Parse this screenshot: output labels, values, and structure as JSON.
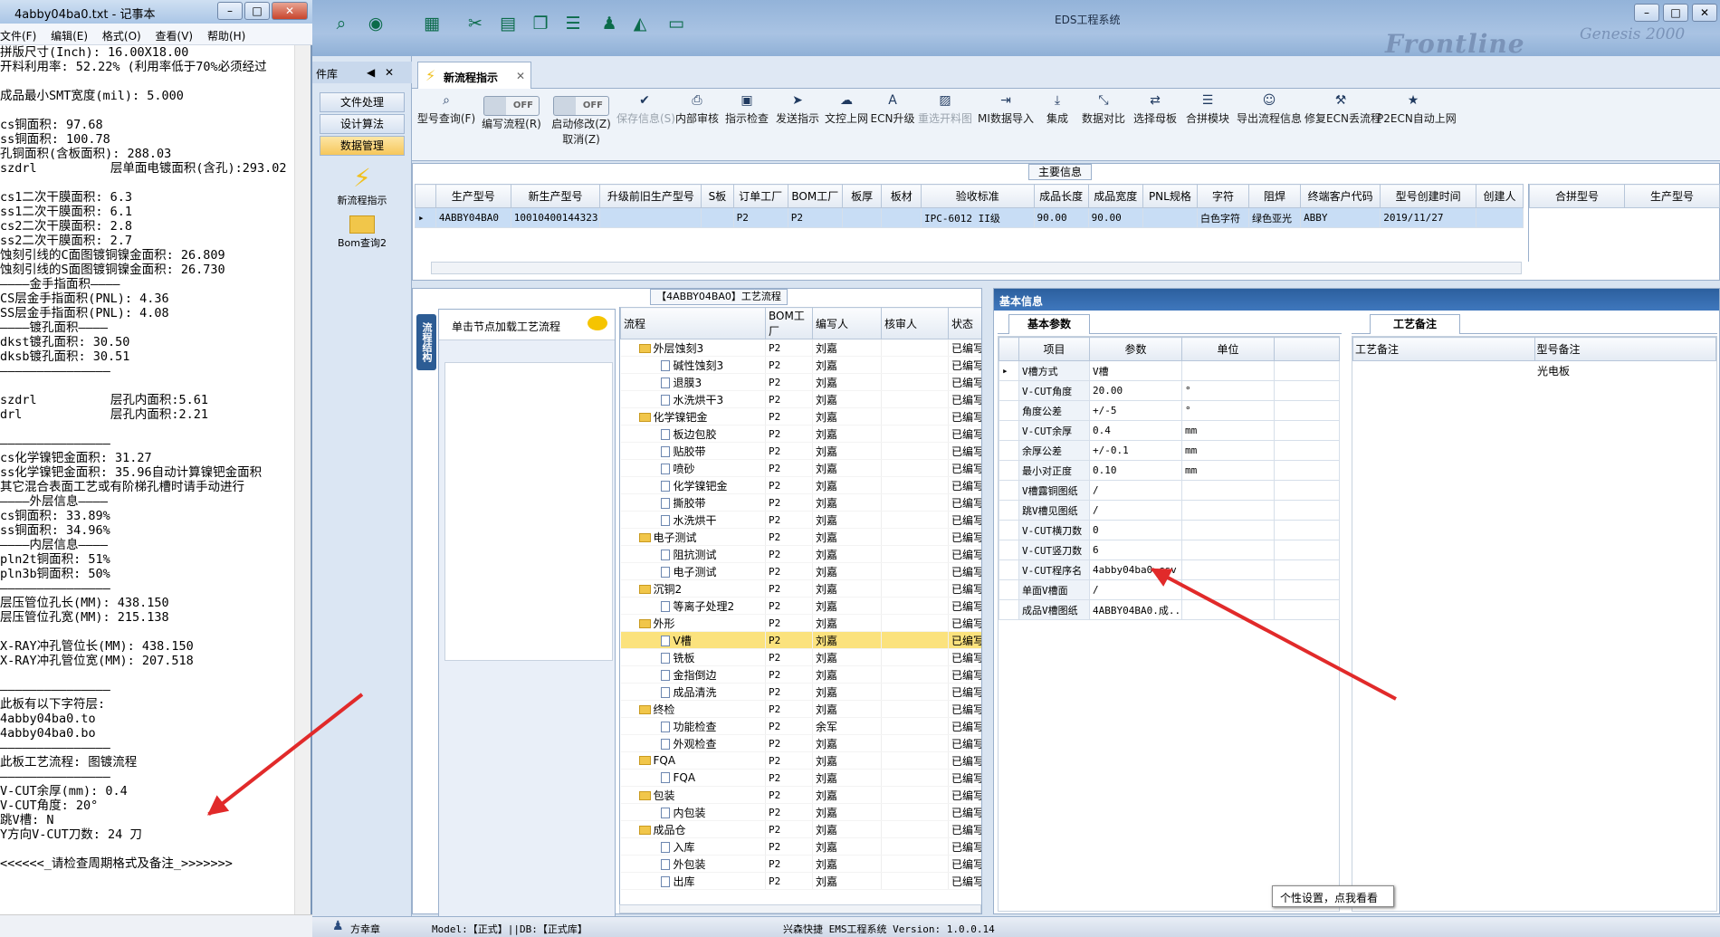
{
  "notepad": {
    "title": "4abby04ba0.txt - 记事本",
    "menu": [
      "文件(F)",
      "编辑(E)",
      "格式(O)",
      "查看(V)",
      "帮助(H)"
    ],
    "lines": [
      "拼版尺寸(Inch): 16.00X18.00",
      "开料利用率: 52.22% (利用率低于70%必须经过",
      "",
      "成品最小SMT宽度(mil): 5.000",
      "",
      "cs铜面积: 97.68",
      "ss铜面积: 100.78",
      "孔铜面积(含板面积): 288.03",
      "szdrl          层单面电镀面积(含孔):293.02",
      "",
      "cs1二次干膜面积: 6.3",
      "ss1二次干膜面积: 6.1",
      "cs2二次干膜面积: 2.8",
      "ss2二次干膜面积: 2.7",
      "蚀刻引线的C面图镀铜镍金面积: 26.809",
      "蚀刻引线的S面图镀铜镍金面积: 26.730",
      "————金手指面积————",
      "CS层金手指面积(PNL): 4.36",
      "SS层金手指面积(PNL): 4.08",
      "————镀孔面积————",
      "dkst镀孔面积: 30.50",
      "dksb镀孔面积: 30.51",
      "———————————————",
      "",
      "szdrl          层孔内面积:5.61",
      "drl            层孔内面积:2.21",
      "",
      "———————————————",
      "cs化学镍钯金面积: 31.27",
      "ss化学镍钯金面积: 35.96自动计算镍钯金面积",
      "其它混合表面工艺或有阶梯孔槽时请手动进行",
      "————外层信息————",
      "cs铜面积: 33.89%",
      "ss铜面积: 34.96%",
      "————内层信息————",
      "pln2t铜面积: 51%",
      "pln3b铜面积: 50%",
      "———————————————",
      "层压管位孔长(MM): 438.150",
      "层压管位孔宽(MM): 215.138",
      "",
      "X-RAY冲孔管位长(MM): 438.150",
      "X-RAY冲孔管位宽(MM): 207.518",
      "",
      "———————————————",
      "此板有以下字符层:",
      "4abby04ba0.to",
      "4abby04ba0.bo",
      "———————————————",
      "此板工艺流程: 图镀流程",
      "———————————————",
      "V-CUT余厚(mm): 0.4",
      "V-CUT角度: 20°",
      "跳V槽: N",
      "Y方向V-CUT刀数: 24 刀",
      "",
      "<<<<<<_请检查周期格式及备注_>>>>>>>"
    ]
  },
  "app": {
    "title": "EDS工程系统",
    "brand": "Frontline",
    "brand2": "Genesis 2000",
    "library_header": "件库",
    "nav": [
      "文件处理",
      "设计算法",
      "数据管理"
    ],
    "nav_icons": [
      {
        "label": "新流程指示",
        "icon": "lightning-icon"
      },
      {
        "label": "Bom查询2",
        "icon": "folder-icon"
      }
    ],
    "active_tab": "新流程指示",
    "ribbon": [
      {
        "label": "型号查询(F)",
        "icon": "search-icon"
      },
      {
        "label": "编写流程(R)",
        "toggle": "OFF"
      },
      {
        "label": "启动修改(Z)",
        "sub": "取消(Z)",
        "toggle": "OFF"
      },
      {
        "label": "保存信息(S)",
        "icon": "check-icon",
        "disabled": true
      },
      {
        "label": "内部审核",
        "icon": "printer-icon"
      },
      {
        "label": "指示检查",
        "icon": "save-icon"
      },
      {
        "label": "发送指示",
        "icon": "send-icon"
      },
      {
        "label": "文控上网",
        "icon": "cloud-icon"
      },
      {
        "label": "ECN升级",
        "icon": "ecn-icon"
      },
      {
        "label": "重选开料图",
        "icon": "image-icon",
        "disabled": true
      },
      {
        "label": "MI数据导入",
        "icon": "import-icon"
      },
      {
        "label": "集成",
        "icon": "download-icon"
      },
      {
        "label": "数据对比",
        "icon": "compare-icon"
      },
      {
        "label": "选择母板",
        "icon": "shuffle-icon"
      },
      {
        "label": "合拼模块",
        "icon": "list-icon"
      },
      {
        "label": "导出流程信息",
        "icon": "smile-icon"
      },
      {
        "label": "修复ECN丢流程",
        "icon": "wrench-icon"
      },
      {
        "label": "P2ECN自动上网",
        "icon": "star-icon"
      }
    ]
  },
  "main_info": {
    "caption": "主要信息",
    "columns": [
      "生产型号",
      "新生产型号",
      "升级前旧生产型号",
      "S板",
      "订单工厂",
      "BOM工厂",
      "板厚",
      "板材",
      "验收标准",
      "成品长度",
      "成品宽度",
      "PNL规格",
      "字符",
      "阻焊",
      "终端客户代码",
      "型号创建时间",
      "创建人"
    ],
    "row": [
      "4ABBY04BA0",
      "10010400144323",
      "",
      "",
      "P2",
      "P2",
      "",
      "",
      "IPC-6012 II级",
      "90.00",
      "90.00",
      "",
      "白色字符",
      "绿色亚光",
      "ABBY",
      "2019/11/27",
      ""
    ],
    "right_columns": [
      "合拼型号",
      "生产型号"
    ]
  },
  "flow": {
    "caption": "【4ABBY04BA0】工艺流程",
    "vtab": "流程结构",
    "load_hint": "单击节点加载工艺流程",
    "columns": [
      "流程",
      "BOM工厂",
      "编写人",
      "核审人",
      "状态"
    ],
    "rows": [
      {
        "level": 1,
        "name": "外层蚀刻3",
        "bom": "P2",
        "author": "刘嘉",
        "status": "已编写"
      },
      {
        "level": 2,
        "name": "碱性蚀刻3",
        "bom": "P2",
        "author": "刘嘉",
        "status": "已编写"
      },
      {
        "level": 2,
        "name": "退膜3",
        "bom": "P2",
        "author": "刘嘉",
        "status": "已编写"
      },
      {
        "level": 2,
        "name": "水洗烘干3",
        "bom": "P2",
        "author": "刘嘉",
        "status": "已编写"
      },
      {
        "level": 1,
        "name": "化学镍钯金",
        "bom": "P2",
        "author": "刘嘉",
        "status": "已编写"
      },
      {
        "level": 2,
        "name": "板边包胶",
        "bom": "P2",
        "author": "刘嘉",
        "status": "已编写"
      },
      {
        "level": 2,
        "name": "贴胶带",
        "bom": "P2",
        "author": "刘嘉",
        "status": "已编写"
      },
      {
        "level": 2,
        "name": "喷砂",
        "bom": "P2",
        "author": "刘嘉",
        "status": "已编写"
      },
      {
        "level": 2,
        "name": "化学镍钯金",
        "bom": "P2",
        "author": "刘嘉",
        "status": "已编写"
      },
      {
        "level": 2,
        "name": "撕胶带",
        "bom": "P2",
        "author": "刘嘉",
        "status": "已编写"
      },
      {
        "level": 2,
        "name": "水洗烘干",
        "bom": "P2",
        "author": "刘嘉",
        "status": "已编写"
      },
      {
        "level": 1,
        "name": "电子测试",
        "bom": "P2",
        "author": "刘嘉",
        "status": "已编写"
      },
      {
        "level": 2,
        "name": "阻抗测试",
        "bom": "P2",
        "author": "刘嘉",
        "status": "已编写"
      },
      {
        "level": 2,
        "name": "电子测试",
        "bom": "P2",
        "author": "刘嘉",
        "status": "已编写"
      },
      {
        "level": 1,
        "name": "沉铜2",
        "bom": "P2",
        "author": "刘嘉",
        "status": "已编写"
      },
      {
        "level": 2,
        "name": "等离子处理2",
        "bom": "P2",
        "author": "刘嘉",
        "status": "已编写"
      },
      {
        "level": 1,
        "name": "外形",
        "bom": "P2",
        "author": "刘嘉",
        "status": "已编写"
      },
      {
        "level": 2,
        "name": "V槽",
        "bom": "P2",
        "author": "刘嘉",
        "status": "已编写",
        "selected": true
      },
      {
        "level": 2,
        "name": "铣板",
        "bom": "P2",
        "author": "刘嘉",
        "status": "已编写"
      },
      {
        "level": 2,
        "name": "金指倒边",
        "bom": "P2",
        "author": "刘嘉",
        "status": "已编写"
      },
      {
        "level": 2,
        "name": "成品清洗",
        "bom": "P2",
        "author": "刘嘉",
        "status": "已编写"
      },
      {
        "level": 1,
        "name": "终检",
        "bom": "P2",
        "author": "刘嘉",
        "status": "已编写"
      },
      {
        "level": 2,
        "name": "功能检查",
        "bom": "P2",
        "author": "余军",
        "status": "已编写"
      },
      {
        "level": 2,
        "name": "外观检查",
        "bom": "P2",
        "author": "刘嘉",
        "status": "已编写"
      },
      {
        "level": 1,
        "name": "FQA",
        "bom": "P2",
        "author": "刘嘉",
        "status": "已编写"
      },
      {
        "level": 2,
        "name": "FQA",
        "bom": "P2",
        "author": "刘嘉",
        "status": "已编写"
      },
      {
        "level": 1,
        "name": "包装",
        "bom": "P2",
        "author": "刘嘉",
        "status": "已编写"
      },
      {
        "level": 2,
        "name": "内包装",
        "bom": "P2",
        "author": "刘嘉",
        "status": "已编写"
      },
      {
        "level": 1,
        "name": "成品仓",
        "bom": "P2",
        "author": "刘嘉",
        "status": "已编写"
      },
      {
        "level": 2,
        "name": "入库",
        "bom": "P2",
        "author": "刘嘉",
        "status": "已编写"
      },
      {
        "level": 2,
        "name": "外包装",
        "bom": "P2",
        "author": "刘嘉",
        "status": "已编写"
      },
      {
        "level": 2,
        "name": "出库",
        "bom": "P2",
        "author": "刘嘉",
        "status": "已编写"
      }
    ]
  },
  "basic": {
    "header": "基本信息",
    "tab": "基本参数",
    "columns": [
      "项目",
      "参数",
      "单位"
    ],
    "params": [
      {
        "name": "V槽方式",
        "value": "V槽",
        "unit": ""
      },
      {
        "name": "V-CUT角度",
        "value": "20.00",
        "unit": "°"
      },
      {
        "name": "角度公差",
        "value": "+/-5",
        "unit": "°"
      },
      {
        "name": "V-CUT余厚",
        "value": "0.4",
        "unit": "mm"
      },
      {
        "name": "余厚公差",
        "value": "+/-0.1",
        "unit": "mm"
      },
      {
        "name": "最小对正度",
        "value": "0.10",
        "unit": "mm"
      },
      {
        "name": "V槽露铜图纸",
        "value": "/",
        "unit": ""
      },
      {
        "name": "跳V槽见图纸",
        "value": "/",
        "unit": ""
      },
      {
        "name": "V-CUT横刀数",
        "value": "0",
        "unit": ""
      },
      {
        "name": "V-CUT竖刀数",
        "value": "6",
        "unit": ""
      },
      {
        "name": "V-CUT程序名",
        "value": "4abby04ba0.csv",
        "unit": ""
      },
      {
        "name": "单面V槽面",
        "value": "/",
        "unit": ""
      },
      {
        "name": "成品V槽图纸",
        "value": "4ABBY04BA0.成...",
        "unit": ""
      }
    ],
    "remark_tab": "工艺备注",
    "remark_columns": [
      "工艺备注",
      "型号备注"
    ],
    "model_remark": "光电板"
  },
  "statusbar": {
    "user": "方幸章",
    "model_text": "Model:【正式】||DB:【正式库】",
    "version": "兴森快捷 EMS工程系统 Version: 1.0.0.14"
  },
  "tooltip": "个性设置，点我看看",
  "colors": {
    "accent": "#2c5f9e",
    "selected_row": "#fbe27d",
    "arrow": "#e12a2a"
  }
}
